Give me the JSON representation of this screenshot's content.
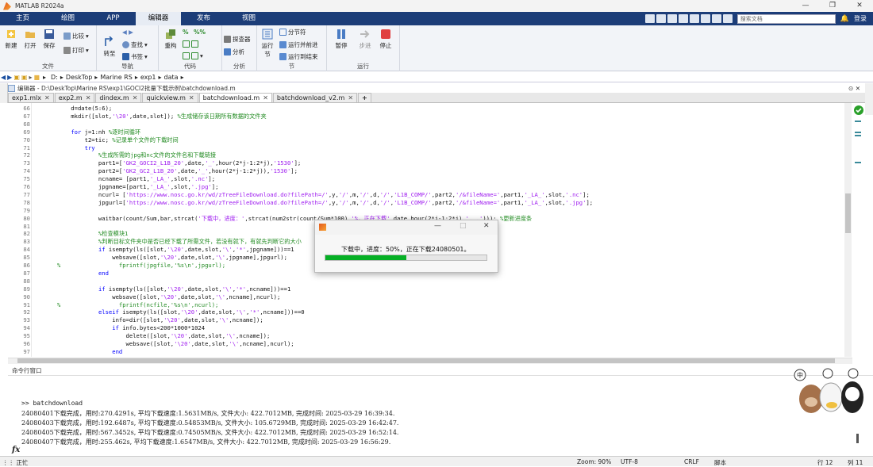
{
  "window": {
    "title": "MATLAB R2024a",
    "buttons": [
      "—",
      "❐",
      "✕"
    ]
  },
  "ribbon_tabs": [
    {
      "label": "主页"
    },
    {
      "label": "绘图"
    },
    {
      "label": "APP"
    },
    {
      "label": "编辑器",
      "active": true
    },
    {
      "label": "发布"
    },
    {
      "label": "视图"
    }
  ],
  "search": {
    "placeholder": "搜索文档"
  },
  "login": "登录",
  "ribbon": {
    "file": {
      "label": "文件",
      "new": "新建",
      "open": "打开",
      "save": "保存",
      "compare": "比较",
      "print": "打印"
    },
    "nav": {
      "label": "导航",
      "goto": "转至",
      "find": "查找",
      "bookmark": "书签"
    },
    "code": {
      "label": "代码",
      "refactor": "重构",
      "pct": "%",
      "pctpct": "%%"
    },
    "analyze": {
      "label": "分析",
      "explorer": "探查器",
      "analyze": "分析"
    },
    "section": {
      "label": "节",
      "run_section": "运行节",
      "split": "分节符",
      "run_advance": "运行并前进",
      "run_to_end": "运行到结束"
    },
    "run": {
      "label": "运行",
      "pause": "暂停",
      "step": "步进",
      "stop": "停止"
    }
  },
  "address": {
    "path": [
      "D:",
      "DeskTop",
      "Marine RS",
      "exp1",
      "data"
    ]
  },
  "editor": {
    "header": "编辑器 - D:\\DeskTop\\Marine RS\\exp1\\GOCI2批量下载示例\\batchdownload.m",
    "tabs": [
      {
        "label": "exp1.mlx"
      },
      {
        "label": "exp2.m"
      },
      {
        "label": "dindex.m"
      },
      {
        "label": "quickview.m"
      },
      {
        "label": "batchdownload.m",
        "active": true
      },
      {
        "label": "batchdownload_v2.m"
      }
    ],
    "lines": [
      {
        "n": "66",
        "t": "    d=date(5:6);"
      },
      {
        "n": "67",
        "t": "    mkdir([slot,'\\20',date,slot]); %生成储存该日期所有数据的文件夹"
      },
      {
        "n": "68",
        "t": ""
      },
      {
        "n": "69",
        "t": "    for j=1:nh %逐时间循环"
      },
      {
        "n": "70",
        "t": "        t2=tic; %记录单个文件的下载时间"
      },
      {
        "n": "71",
        "t": "        try"
      },
      {
        "n": "72",
        "t": "            %生成所需的jpg和nc文件的文件名和下载链接"
      },
      {
        "n": "73",
        "t": "            part1=['GK2_GOCI2_L1B_20',date,'_',hour(2*j-1:2*j),'1530'];"
      },
      {
        "n": "74",
        "t": "            part2=['GK2_GC2_L1B_20',date,'_',hour(2*j-1:2*j)),'1530'];"
      },
      {
        "n": "75",
        "t": "            ncname= [part1,'_LA_',slot,'.nc'];"
      },
      {
        "n": "76",
        "t": "            jpgname=[part1,'_LA_',slot,'.jpg'];"
      },
      {
        "n": "77",
        "t": "            ncurl= ['https://www.nosc.go.kr/wd/zTreeFileDownload.do?filePath=/',y,'/',m,'/',d,'/','L1B_COMP/',part2,'/&fileName=',part1,'_LA_',slot,'.nc'];"
      },
      {
        "n": "78",
        "t": "            jpgurl=['https://www.nosc.go.kr/wd/zTreeFileDownload.do?filePath=/',y,'/',m,'/',d,'/','L1B_COMP/',part2,'/&fileName=',part1,'_LA_',slot,'.jpg'];"
      },
      {
        "n": "79",
        "t": ""
      },
      {
        "n": "80",
        "t": "            waitbar(count/Sum,bar,strcat('下载中，进度：',strcat(num2str(count/Sum*100),'%，正在下载',date,hour(2*j-1:2*j),'...'))); %更新进度条"
      },
      {
        "n": "81",
        "t": ""
      },
      {
        "n": "82",
        "t": "            %检查模块1"
      },
      {
        "n": "83",
        "t": "            %判断目标文件夹中是否已经下载了所需文件，若没有就下，有就先判断它的大小"
      },
      {
        "n": "84",
        "t": "            if isempty(ls([slot,'\\20',date,slot,'\\','*',jpgname]))==1"
      },
      {
        "n": "85",
        "t": "                websave([slot,'\\20',date,slot,'\\',jpgname],jpgurl);"
      },
      {
        "n": "86",
        "t": "%                 fprintf(jpgfile,'%s\\n',jpgurl);"
      },
      {
        "n": "87",
        "t": "            end"
      },
      {
        "n": "88",
        "t": ""
      },
      {
        "n": "89",
        "t": "            if isempty(ls([slot,'\\20',date,slot,'\\','*',ncname]))==1"
      },
      {
        "n": "90",
        "t": "                websave([slot,'\\20',date,slot,'\\',ncname],ncurl);"
      },
      {
        "n": "91",
        "t": "%                 fprintf(ncfile,'%s\\n',ncurl);"
      },
      {
        "n": "92",
        "t": "            elseif isempty(ls([slot,'\\20',date,slot,'\\','*',ncname]))==0"
      },
      {
        "n": "93",
        "t": "                info=dir([slot,'\\20',date,slot,'\\',ncname]);"
      },
      {
        "n": "94",
        "t": "                if info.bytes<200*1000*1024"
      },
      {
        "n": "95",
        "t": "                    delete([slot,'\\20',date,slot,'\\',ncname]);"
      },
      {
        "n": "96",
        "t": "                    websave([slot,'\\20',date,slot,'\\',ncname],ncurl);"
      },
      {
        "n": "97",
        "t": "                end"
      }
    ]
  },
  "command_window": {
    "title": "命令行窗口",
    "prompt": ">> batchdownload",
    "lines": [
      "24080401下载完成，用时:270.4291s, 平均下载速度:1.5631MB/s, 文件大小: 422.7012MB, 完成时间: 2025-03-29 16:39:34.",
      "24080403下载完成，用时:192.6487s, 平均下载速度:0.54853MB/s, 文件大小: 105.6729MB, 完成时间: 2025-03-29 16:42:47.",
      "24080405下载完成，用时:567.3452s, 平均下载速度:0.74505MB/s, 文件大小: 422.7012MB, 完成时间: 2025-03-29 16:52:14.",
      "24080407下载完成，用时:255.462s, 平均下载速度:1.6547MB/s, 文件大小: 422.7012MB, 完成时间: 2025-03-29 16:56:29."
    ],
    "fx": "fx"
  },
  "dialog": {
    "message": "下载中，进度：50%，正在下载24080501。",
    "progress": 0.5
  },
  "status": {
    "left": "正忙",
    "zoom": "Zoom: 90%",
    "encoding": "UTF-8",
    "eol": "CRLF",
    "mode": "脚本",
    "row": "行 12",
    "col": "列 11"
  },
  "colors": {
    "tab_bar": "#1c3d78",
    "progress": "#06b025",
    "keyword": "#0000ff",
    "comment": "#228b22",
    "string": "#a020f0"
  }
}
